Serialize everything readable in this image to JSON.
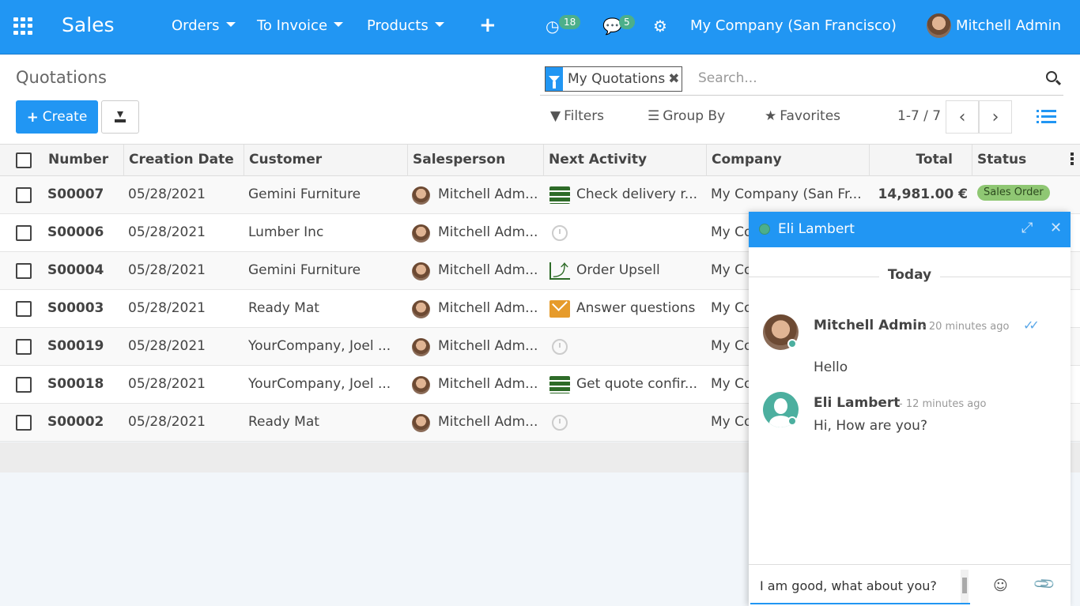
{
  "navbar": {
    "brand": "Sales",
    "menus": [
      {
        "label": "Orders"
      },
      {
        "label": "To Invoice"
      },
      {
        "label": "Products"
      }
    ],
    "activity_count": "18",
    "message_count": "5",
    "company": "My Company (San Francisco)",
    "user": "Mitchell Admin",
    "accent": "#2196f3"
  },
  "control": {
    "breadcrumb": "Quotations",
    "create_label": "Create",
    "facet": "My Quotations",
    "search_placeholder": "Search...",
    "filters": "Filters",
    "group_by": "Group By",
    "favorites": "Favorites",
    "pager": "1-7 / 7"
  },
  "table": {
    "headers": [
      "Number",
      "Creation Date",
      "Customer",
      "Salesperson",
      "Next Activity",
      "Company",
      "Total",
      "Status"
    ],
    "rows": [
      {
        "number": "S00007",
        "date": "05/28/2021",
        "customer": "Gemini Furniture",
        "salesperson": "Mitchell Adm...",
        "activity": "Check delivery r...",
        "activity_icon": "todo-icon",
        "company": "My Company (San Fr...",
        "total": "14,981.00 €",
        "status": "Sales Order"
      },
      {
        "number": "S00006",
        "date": "05/28/2021",
        "customer": "Lumber Inc",
        "salesperson": "Mitchell Adm...",
        "activity": "",
        "activity_icon": "clock-icon",
        "company": "My Co",
        "total": "",
        "status": ""
      },
      {
        "number": "S00004",
        "date": "05/28/2021",
        "customer": "Gemini Furniture",
        "salesperson": "Mitchell Adm...",
        "activity": "Order Upsell",
        "activity_icon": "trend-icon",
        "company": "My Co",
        "total": "",
        "status": ""
      },
      {
        "number": "S00003",
        "date": "05/28/2021",
        "customer": "Ready Mat",
        "salesperson": "Mitchell Adm...",
        "activity": "Answer questions",
        "activity_icon": "envelope-icon",
        "company": "My Co",
        "total": "",
        "status": ""
      },
      {
        "number": "S00019",
        "date": "05/28/2021",
        "customer": "YourCompany, Joel ...",
        "salesperson": "Mitchell Adm...",
        "activity": "",
        "activity_icon": "clock-icon",
        "company": "My Co",
        "total": "",
        "status": ""
      },
      {
        "number": "S00018",
        "date": "05/28/2021",
        "customer": "YourCompany, Joel ...",
        "salesperson": "Mitchell Adm...",
        "activity": "Get quote confir...",
        "activity_icon": "todo-icon",
        "company": "My Co",
        "total": "",
        "status": ""
      },
      {
        "number": "S00002",
        "date": "05/28/2021",
        "customer": "Ready Mat",
        "salesperson": "Mitchell Adm...",
        "activity": "",
        "activity_icon": "clock-icon",
        "company": "My Co",
        "total": "",
        "status": ""
      }
    ]
  },
  "chat": {
    "title": "Eli Lambert",
    "day": "Today",
    "messages": [
      {
        "author": "Mitchell Admin",
        "when": "- 20 minutes ago",
        "text": "Hello"
      },
      {
        "author": "Eli Lambert",
        "when": "- 12 minutes ago",
        "text": "Hi, How are you?"
      }
    ],
    "draft": "I am good, what about you?"
  }
}
